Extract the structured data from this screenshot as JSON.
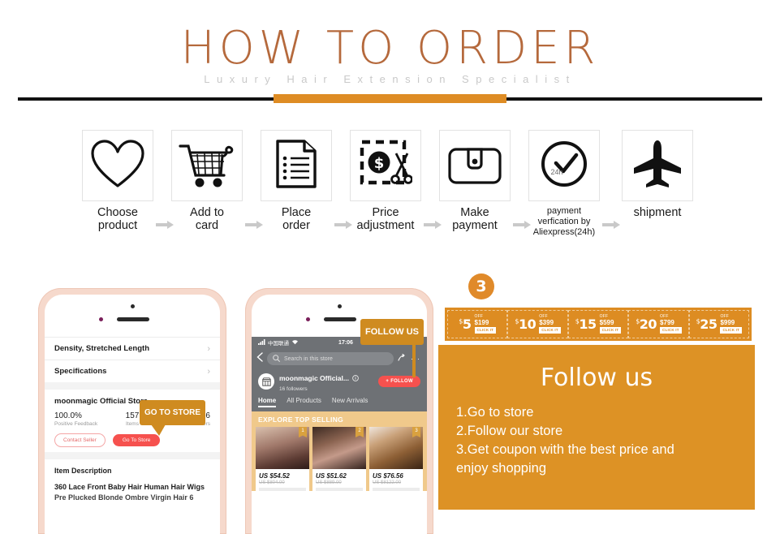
{
  "header": {
    "title": "HOW TO ORDER",
    "subtitle": "Luxury Hair Extension Specialist",
    "accent_color": "#de8c24",
    "title_color": "#b5693c"
  },
  "steps": [
    {
      "icon": "heart-icon",
      "line1": "Choose",
      "line2": "product"
    },
    {
      "icon": "shopping-cart-icon",
      "line1": "Add to",
      "line2": "card"
    },
    {
      "icon": "document-icon",
      "line1": "Place",
      "line2": "order"
    },
    {
      "icon": "price-tag-scissors-icon",
      "line1": "Price",
      "line2": "adjustment"
    },
    {
      "icon": "wallet-icon",
      "line1": "Make",
      "line2": "payment"
    },
    {
      "icon": "clock-24h-icon",
      "line1": "payment",
      "line2": "verfication by",
      "line3": "Aliexpress(24h)",
      "badge": "24h"
    },
    {
      "icon": "airplane-icon",
      "line1": "shipment",
      "line2": ""
    }
  ],
  "phone1": {
    "rows": [
      {
        "label": "Density, Stretched Length",
        "chevron": "›"
      },
      {
        "label": "Specifications",
        "chevron": "›"
      }
    ],
    "store_name": "moonmagic Official Store",
    "stats": [
      {
        "value": "100.0%",
        "label": "Positive Feedback"
      },
      {
        "value": "157",
        "label": "Items"
      },
      {
        "value": "16",
        "label": "Followers"
      }
    ],
    "contact_seller": "Contact Seller",
    "go_to_store": "Go To Store",
    "item_description_header": "Item Description",
    "item_description_line1": "360 Lace Front Baby Hair Human Hair Wigs",
    "item_description_line2": "Pre Plucked Blonde Ombre Virgin Hair 6",
    "callout": "GO TO STORE"
  },
  "phone2": {
    "carrier": "中国联通",
    "time": "17:06",
    "search_placeholder": "Search in this store",
    "store_name": "moonmagic Official...",
    "followers": "16  followers",
    "follow_button": "+ FOLLOW",
    "tabs": [
      {
        "label": "Home",
        "active": true
      },
      {
        "label": "All Products",
        "active": false
      },
      {
        "label": "New Arrivals",
        "active": false
      }
    ],
    "banner": "EXPLORE TOP SELLING",
    "products": [
      {
        "rank": "1",
        "price": "US $54.52",
        "old_price": "US $804.00"
      },
      {
        "rank": "2",
        "price": "US $51.62",
        "old_price": "US $889.00"
      },
      {
        "rank": "3",
        "price": "US $76.56",
        "old_price": "US $8122.00"
      }
    ],
    "callout": "FOLLOW US"
  },
  "right_panel": {
    "step_badge": "3",
    "coupons": [
      {
        "amount": "5",
        "currency": "$",
        "off_label": "OFF",
        "over": "$199",
        "cta": "CLICK IT"
      },
      {
        "amount": "10",
        "currency": "$",
        "off_label": "OFF",
        "over": "$399",
        "cta": "CLICK IT"
      },
      {
        "amount": "15",
        "currency": "$",
        "off_label": "OFF",
        "over": "$599",
        "cta": "CLICK IT"
      },
      {
        "amount": "20",
        "currency": "$",
        "off_label": "OFF",
        "over": "$799",
        "cta": "CLICK IT"
      },
      {
        "amount": "25",
        "currency": "$",
        "off_label": "OFF",
        "over": "$999",
        "cta": "CLICK IT"
      }
    ],
    "follow_title": "Follow us",
    "follow_steps": [
      "1.Go to store",
      "2.Follow our store",
      "3.Get coupon with the best price and",
      " enjoy shopping"
    ],
    "panel_color": "#dd9225",
    "coupon_bar_color": "#dd8c22"
  }
}
